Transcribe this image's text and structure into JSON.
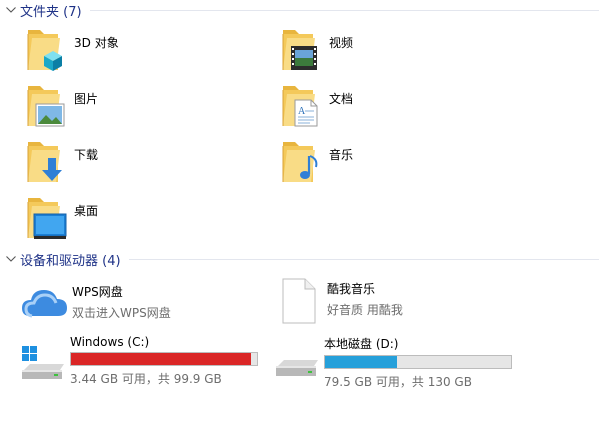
{
  "groups": {
    "folders": {
      "title": "文件夹 (7)"
    },
    "devices": {
      "title": "设备和驱动器 (4)"
    }
  },
  "folders": [
    {
      "label": "3D 对象",
      "icon": "3d-objects-folder-icon"
    },
    {
      "label": "视频",
      "icon": "videos-folder-icon"
    },
    {
      "label": "图片",
      "icon": "pictures-folder-icon"
    },
    {
      "label": "文档",
      "icon": "documents-folder-icon"
    },
    {
      "label": "下载",
      "icon": "downloads-folder-icon"
    },
    {
      "label": "音乐",
      "icon": "music-folder-icon"
    },
    {
      "label": "桌面",
      "icon": "desktop-folder-icon"
    }
  ],
  "devices": [
    {
      "name": "WPS网盘",
      "sub": "双击进入WPS网盘",
      "icon": "wps-cloud-icon"
    },
    {
      "name": "酷我音乐",
      "sub": "好音质 用酷我",
      "icon": "blank-file-icon"
    },
    {
      "name": "Windows (C:)",
      "sub": "3.44 GB 可用，共 99.9 GB",
      "icon": "windows-drive-icon",
      "used_fraction": 0.966,
      "bar_color": "#da2626"
    },
    {
      "name": "本地磁盘 (D:)",
      "sub": "79.5 GB 可用，共 130 GB",
      "icon": "hard-drive-icon",
      "used_fraction": 0.388,
      "bar_color": "#26a0da"
    }
  ],
  "colors": {
    "header_text": "#1e3287",
    "folder_yellow": "#f7d46b",
    "drive_full": "#da2626",
    "drive_normal": "#26a0da"
  }
}
